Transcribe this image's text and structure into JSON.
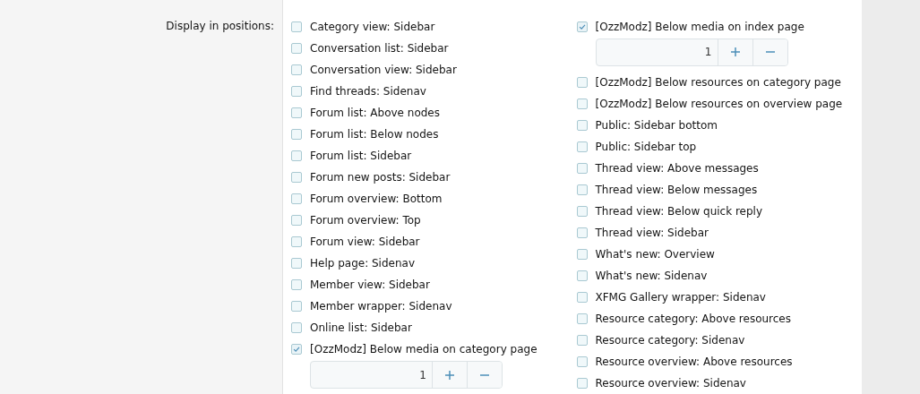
{
  "field_label": "Display in positions:",
  "columns": [
    [
      {
        "label": "Category view: Sidebar",
        "checked": false
      },
      {
        "label": "Conversation list: Sidebar",
        "checked": false
      },
      {
        "label": "Conversation view: Sidebar",
        "checked": false
      },
      {
        "label": "Find threads: Sidenav",
        "checked": false
      },
      {
        "label": "Forum list: Above nodes",
        "checked": false
      },
      {
        "label": "Forum list: Below nodes",
        "checked": false
      },
      {
        "label": "Forum list: Sidebar",
        "checked": false
      },
      {
        "label": "Forum new posts: Sidebar",
        "checked": false
      },
      {
        "label": "Forum overview: Bottom",
        "checked": false
      },
      {
        "label": "Forum overview: Top",
        "checked": false
      },
      {
        "label": "Forum view: Sidebar",
        "checked": false
      },
      {
        "label": "Help page: Sidenav",
        "checked": false
      },
      {
        "label": "Member view: Sidebar",
        "checked": false
      },
      {
        "label": "Member wrapper: Sidenav",
        "checked": false
      },
      {
        "label": "Online list: Sidebar",
        "checked": false
      },
      {
        "label": "[OzzModz] Below media on category page",
        "checked": true,
        "order": "1"
      }
    ],
    [
      {
        "label": "[OzzModz] Below media on index page",
        "checked": true,
        "order": "1"
      },
      {
        "label": "[OzzModz] Below resources on category page",
        "checked": false
      },
      {
        "label": "[OzzModz] Below resources on overview page",
        "checked": false
      },
      {
        "label": "Public: Sidebar bottom",
        "checked": false
      },
      {
        "label": "Public: Sidebar top",
        "checked": false
      },
      {
        "label": "Thread view: Above messages",
        "checked": false
      },
      {
        "label": "Thread view: Below messages",
        "checked": false
      },
      {
        "label": "Thread view: Below quick reply",
        "checked": false
      },
      {
        "label": "Thread view: Sidebar",
        "checked": false
      },
      {
        "label": "What's new: Overview",
        "checked": false
      },
      {
        "label": "What's new: Sidenav",
        "checked": false
      },
      {
        "label": "XFMG Gallery wrapper: Sidenav",
        "checked": false
      },
      {
        "label": "Resource category: Above resources",
        "checked": false
      },
      {
        "label": "Resource category: Sidenav",
        "checked": false
      },
      {
        "label": "Resource overview: Above resources",
        "checked": false
      },
      {
        "label": "Resource overview: Sidenav",
        "checked": false
      }
    ]
  ]
}
